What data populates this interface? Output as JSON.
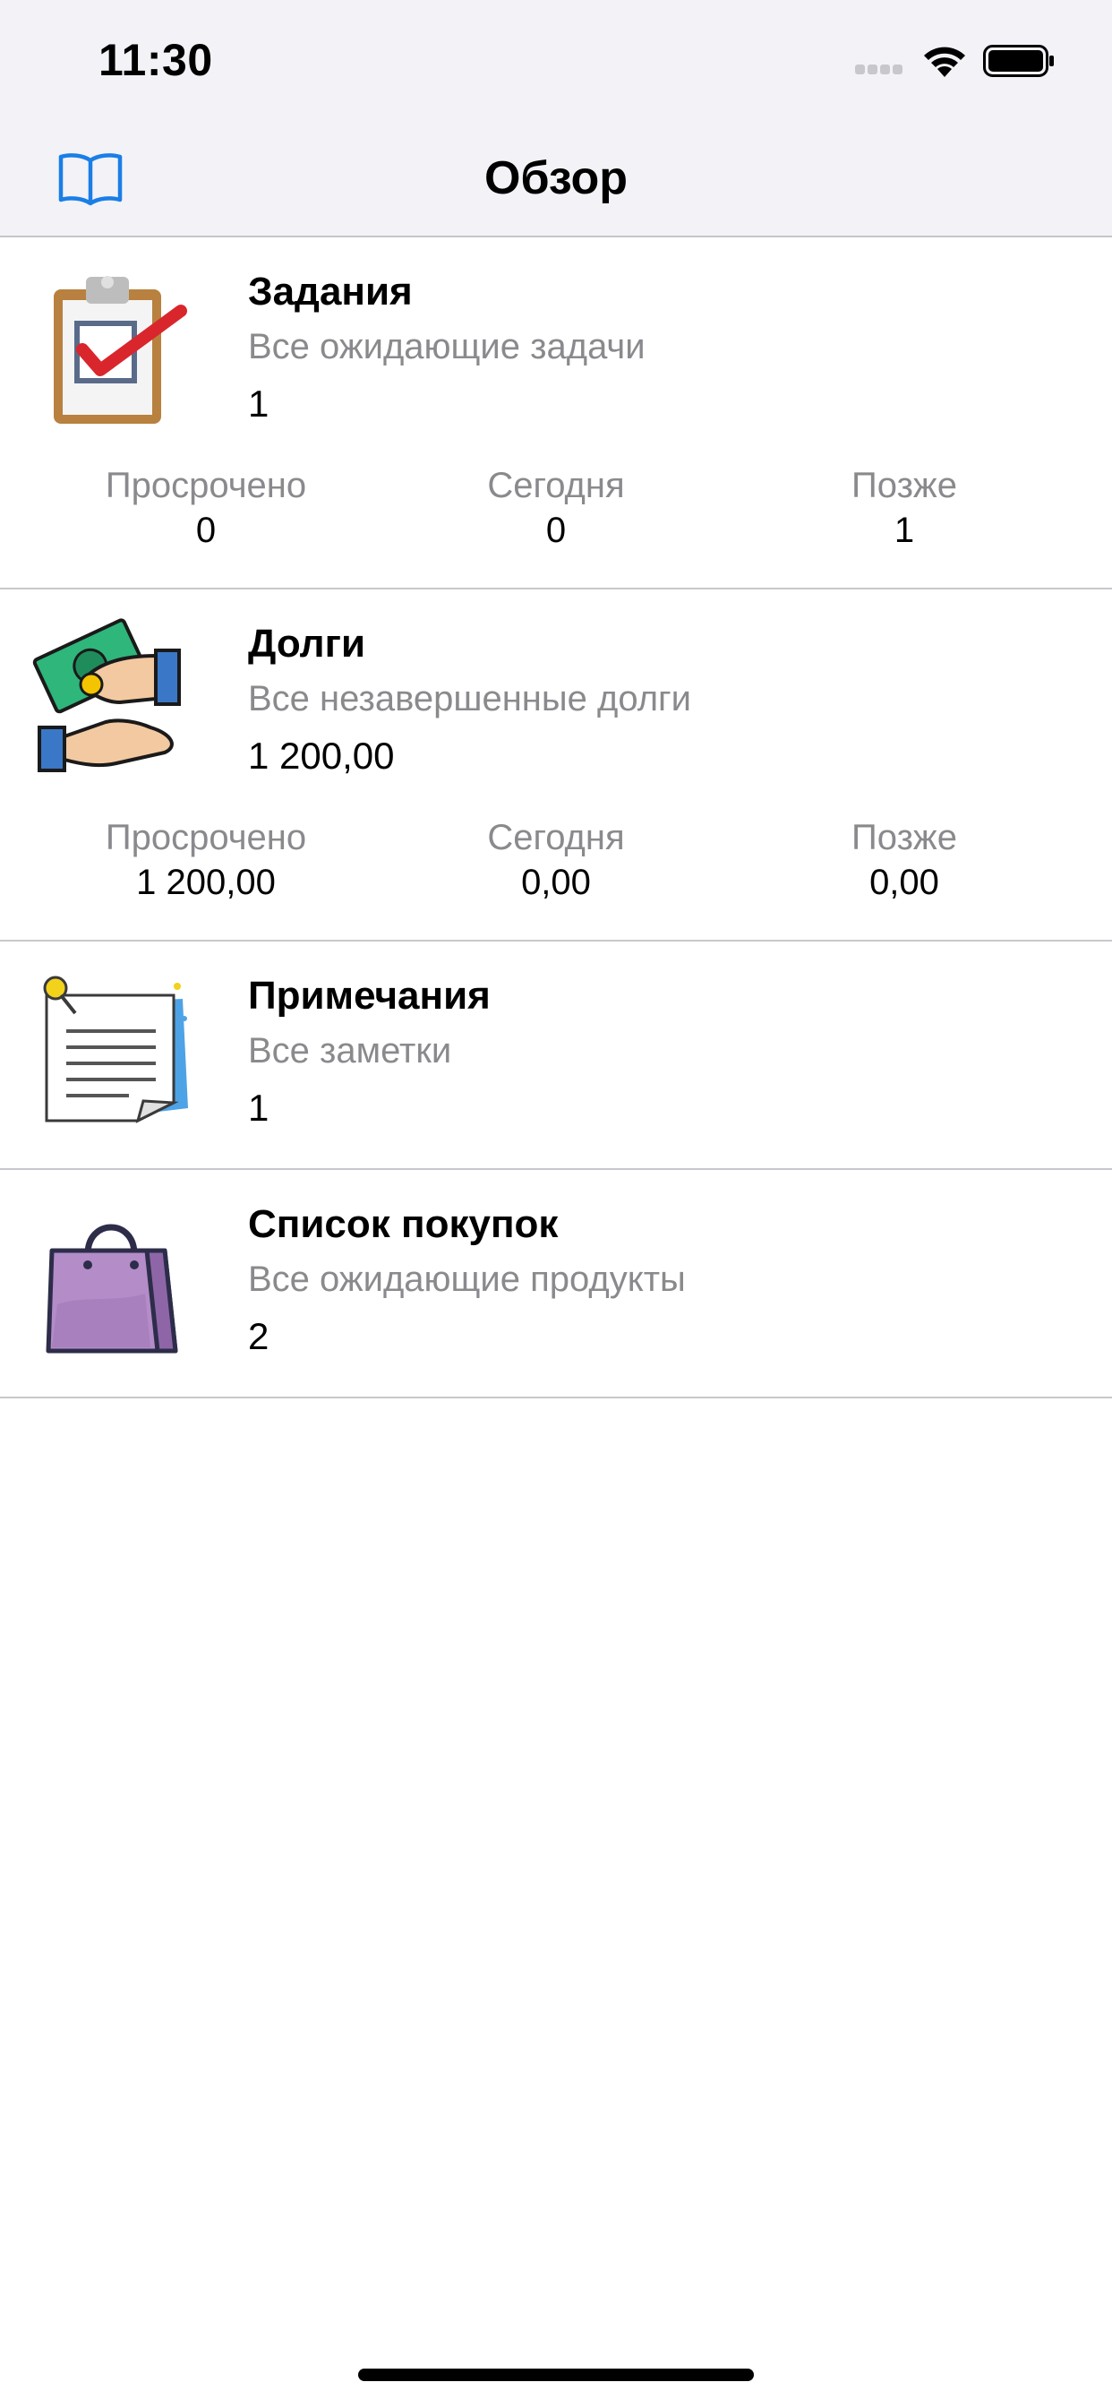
{
  "status_bar": {
    "time": "11:30"
  },
  "nav": {
    "title": "Обзор",
    "left_icon": "book-icon"
  },
  "accent_color": "#1a7ee6",
  "cards": [
    {
      "icon": "clipboard-check-icon",
      "title": "Задания",
      "subtitle": "Все ожидающие задачи",
      "value": "1",
      "stats": [
        {
          "label": "Просрочено",
          "value": "0"
        },
        {
          "label": "Сегодня",
          "value": "0"
        },
        {
          "label": "Позже",
          "value": "1"
        }
      ]
    },
    {
      "icon": "money-hands-icon",
      "title": "Долги",
      "subtitle": "Все незавершенные долги",
      "value": "1 200,00",
      "stats": [
        {
          "label": "Просрочено",
          "value": "1 200,00"
        },
        {
          "label": "Сегодня",
          "value": "0,00"
        },
        {
          "label": "Позже",
          "value": "0,00"
        }
      ]
    },
    {
      "icon": "note-pin-icon",
      "title": "Примечания",
      "subtitle": "Все заметки",
      "value": "1"
    },
    {
      "icon": "shopping-bag-icon",
      "title": "Список покупок",
      "subtitle": "Все ожидающие продукты",
      "value": "2"
    }
  ]
}
